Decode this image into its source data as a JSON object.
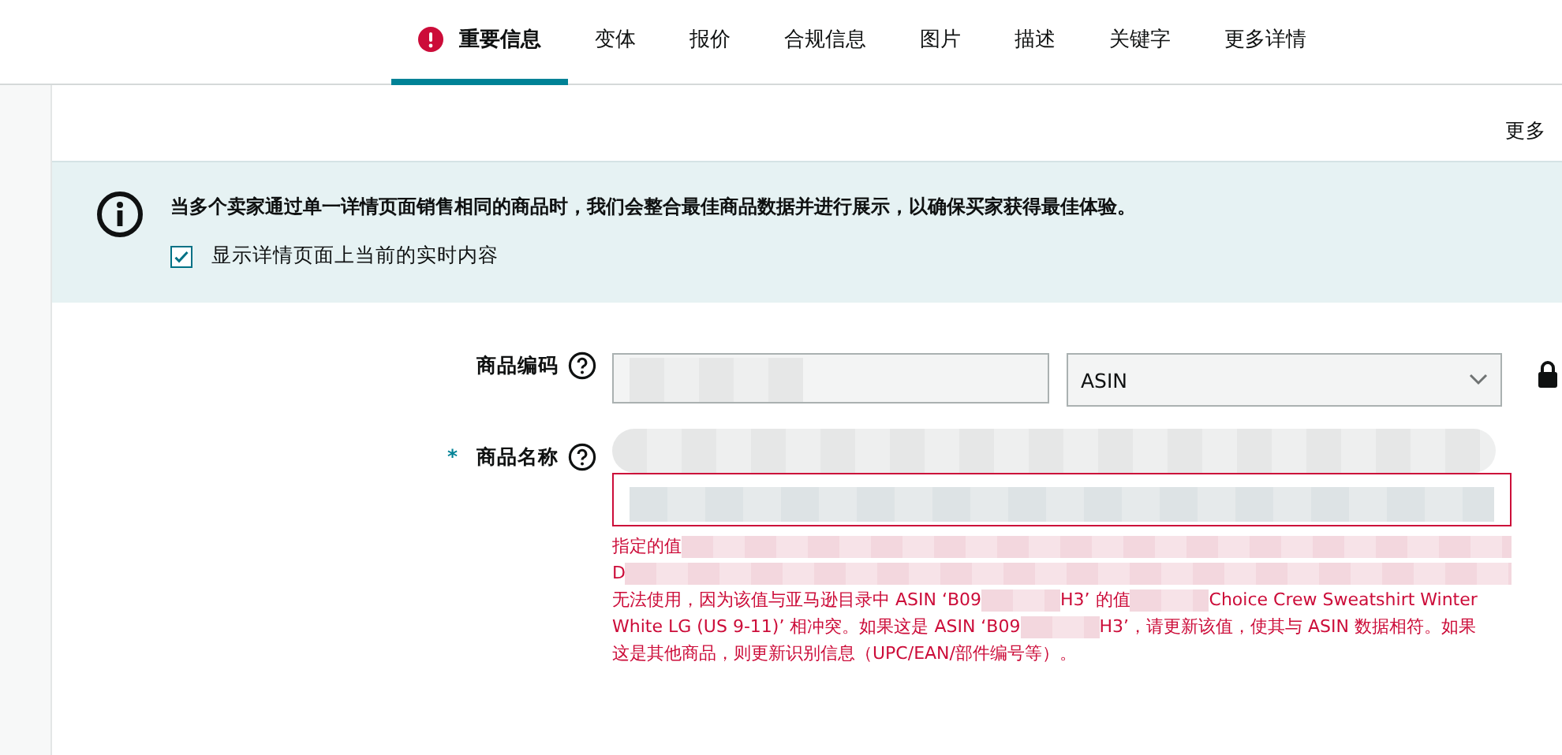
{
  "tabs": [
    {
      "label": "重要信息",
      "selected": true,
      "error": true
    },
    {
      "label": "变体",
      "selected": false,
      "error": false
    },
    {
      "label": "报价",
      "selected": false,
      "error": false
    },
    {
      "label": "合规信息",
      "selected": false,
      "error": false
    },
    {
      "label": "图片",
      "selected": false,
      "error": false
    },
    {
      "label": "描述",
      "selected": false,
      "error": false
    },
    {
      "label": "关键字",
      "selected": false,
      "error": false
    },
    {
      "label": "更多详情",
      "selected": false,
      "error": false
    }
  ],
  "top_link": "更多",
  "banner": {
    "message": "当多个卖家通过单一详情页面销售相同的商品时，我们会整合最佳商品数据并进行展示，以确保买家获得最佳体验。",
    "checkbox": {
      "label": "显示详情页面上当前的实时内容",
      "checked": true
    }
  },
  "fields": [
    {
      "kind": "id",
      "label": "商品编码",
      "select": "ASIN",
      "locked": true
    },
    {
      "kind": "name",
      "required_mark": "*",
      "label": "商品名称",
      "error_lines": [
        [
          {
            "text": "指定的值"
          },
          {
            "kind": "redaction"
          }
        ],
        [
          {
            "text": "D"
          },
          {
            "kind": "redaction"
          }
        ],
        [
          {
            "text": "无法使用，因为该值与亚马逊目录中 ASIN ‘B09"
          },
          {
            "kind": "redaction"
          },
          {
            "text": "H3’ 的值"
          },
          {
            "kind": "redaction"
          },
          {
            "text": "Choice Crew Sweatshirt Winter"
          }
        ],
        [
          {
            "text": "White LG (US 9-11)’ 相冲突。如果这是 ASIN ‘B09"
          },
          {
            "kind": "redaction"
          },
          {
            "text": "H3’，请更新该值，使其与 ASIN 数据相符。如果"
          }
        ],
        [
          {
            "text": "这是其他商品，则更新识别信息（UPC/EAN/部件编号等）。"
          }
        ]
      ]
    }
  ]
}
